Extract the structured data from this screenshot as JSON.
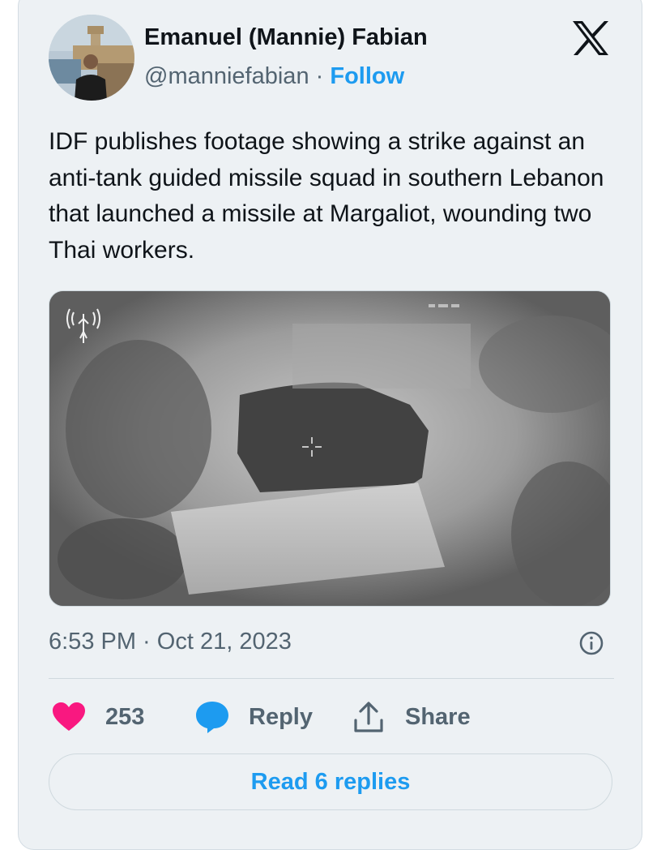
{
  "author": {
    "name": "Emanuel (Mannie) Fabian",
    "handle": "@manniefabian",
    "separator": "·",
    "follow_label": "Follow"
  },
  "brand_icon": "x-logo-icon",
  "tweet": {
    "text": "IDF publishes footage showing a strike against an anti-tank guided missile squad in southern Lebanon that launched a missile at Margaliot, wounding two Thai workers.",
    "timestamp": "6:53 PM · Oct 21, 2023"
  },
  "media": {
    "type": "video-thumbnail",
    "watermark_icon": "idf-emblem-icon",
    "overlay_icon": "crosshair-icon"
  },
  "actions": {
    "like_icon": "heart-icon",
    "like_count": "253",
    "reply_icon": "speech-bubble-icon",
    "reply_label": "Reply",
    "share_icon": "share-upload-icon",
    "share_label": "Share"
  },
  "read_replies_label": "Read 6 replies",
  "colors": {
    "accent": "#1d9bf0",
    "like": "#f91880",
    "text": "#0f1419",
    "secondary_text": "#536471",
    "card_background": "#edf1f4"
  }
}
